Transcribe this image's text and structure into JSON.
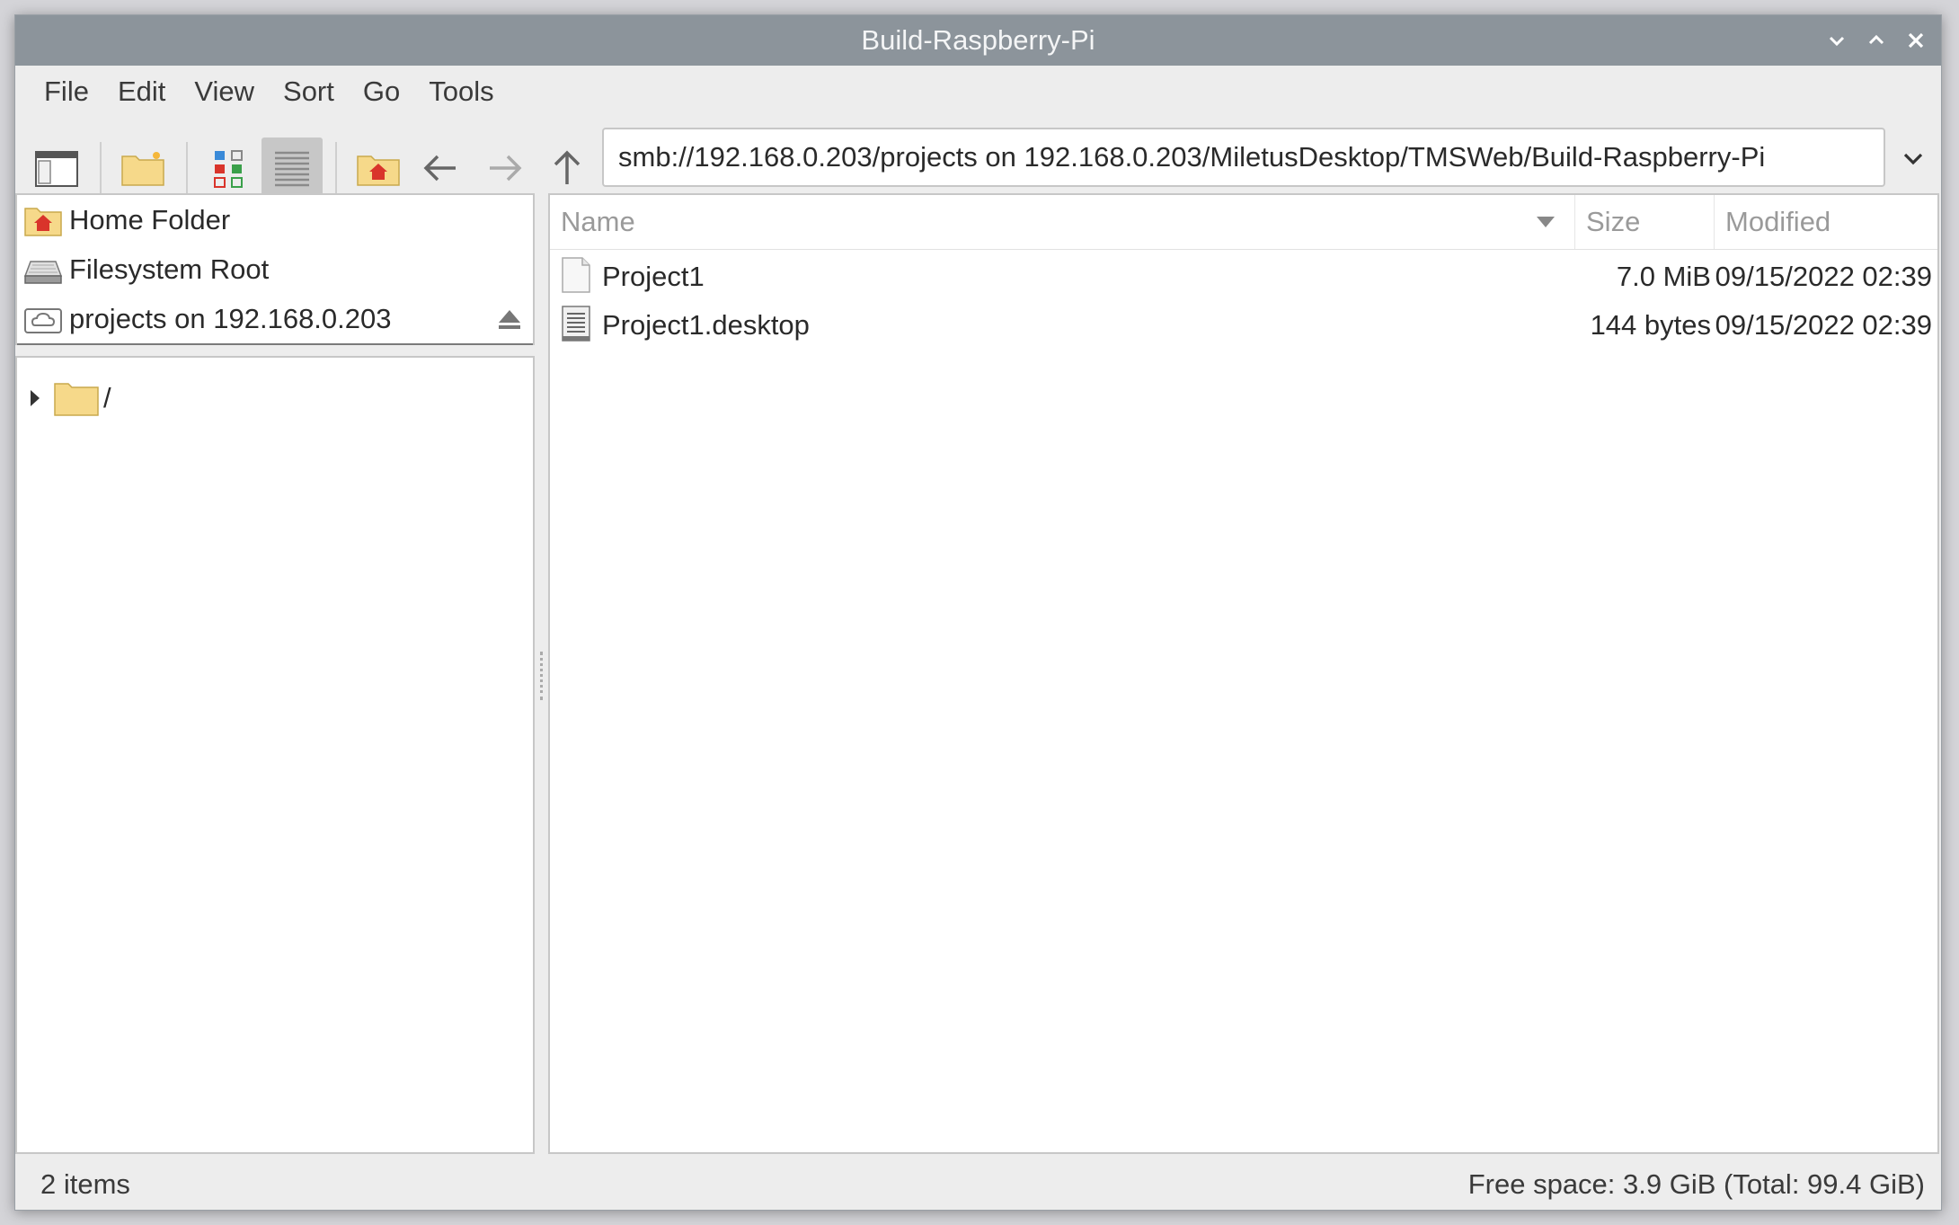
{
  "window": {
    "title": "Build-Raspberry-Pi"
  },
  "menu": [
    "File",
    "Edit",
    "View",
    "Sort",
    "Go",
    "Tools"
  ],
  "toolbar": {
    "path": "smb://192.168.0.203/projects on 192.168.0.203/MiletusDesktop/TMSWeb/Build-Raspberry-Pi"
  },
  "places": [
    {
      "label": "Home Folder",
      "icon": "home-folder-icon"
    },
    {
      "label": "Filesystem Root",
      "icon": "drive-icon"
    },
    {
      "label": "projects on 192.168.0.203",
      "icon": "network-share-icon"
    }
  ],
  "tree": {
    "root_label": "/"
  },
  "columns": {
    "name": "Name",
    "size": "Size",
    "modified": "Modified"
  },
  "files": [
    {
      "name": "Project1",
      "size": "7.0 MiB",
      "modified": "09/15/2022 02:39",
      "icon": "file-icon"
    },
    {
      "name": "Project1.desktop",
      "size": "144 bytes",
      "modified": "09/15/2022 02:39",
      "icon": "text-file-icon"
    }
  ],
  "status": {
    "items": "2 items",
    "free_space": "Free space: 3.9 GiB (Total: 99.4 GiB)"
  },
  "colors": {
    "titlebar": "#8c949b",
    "folder": "#f6d98a",
    "home_accent": "#d9342b"
  }
}
